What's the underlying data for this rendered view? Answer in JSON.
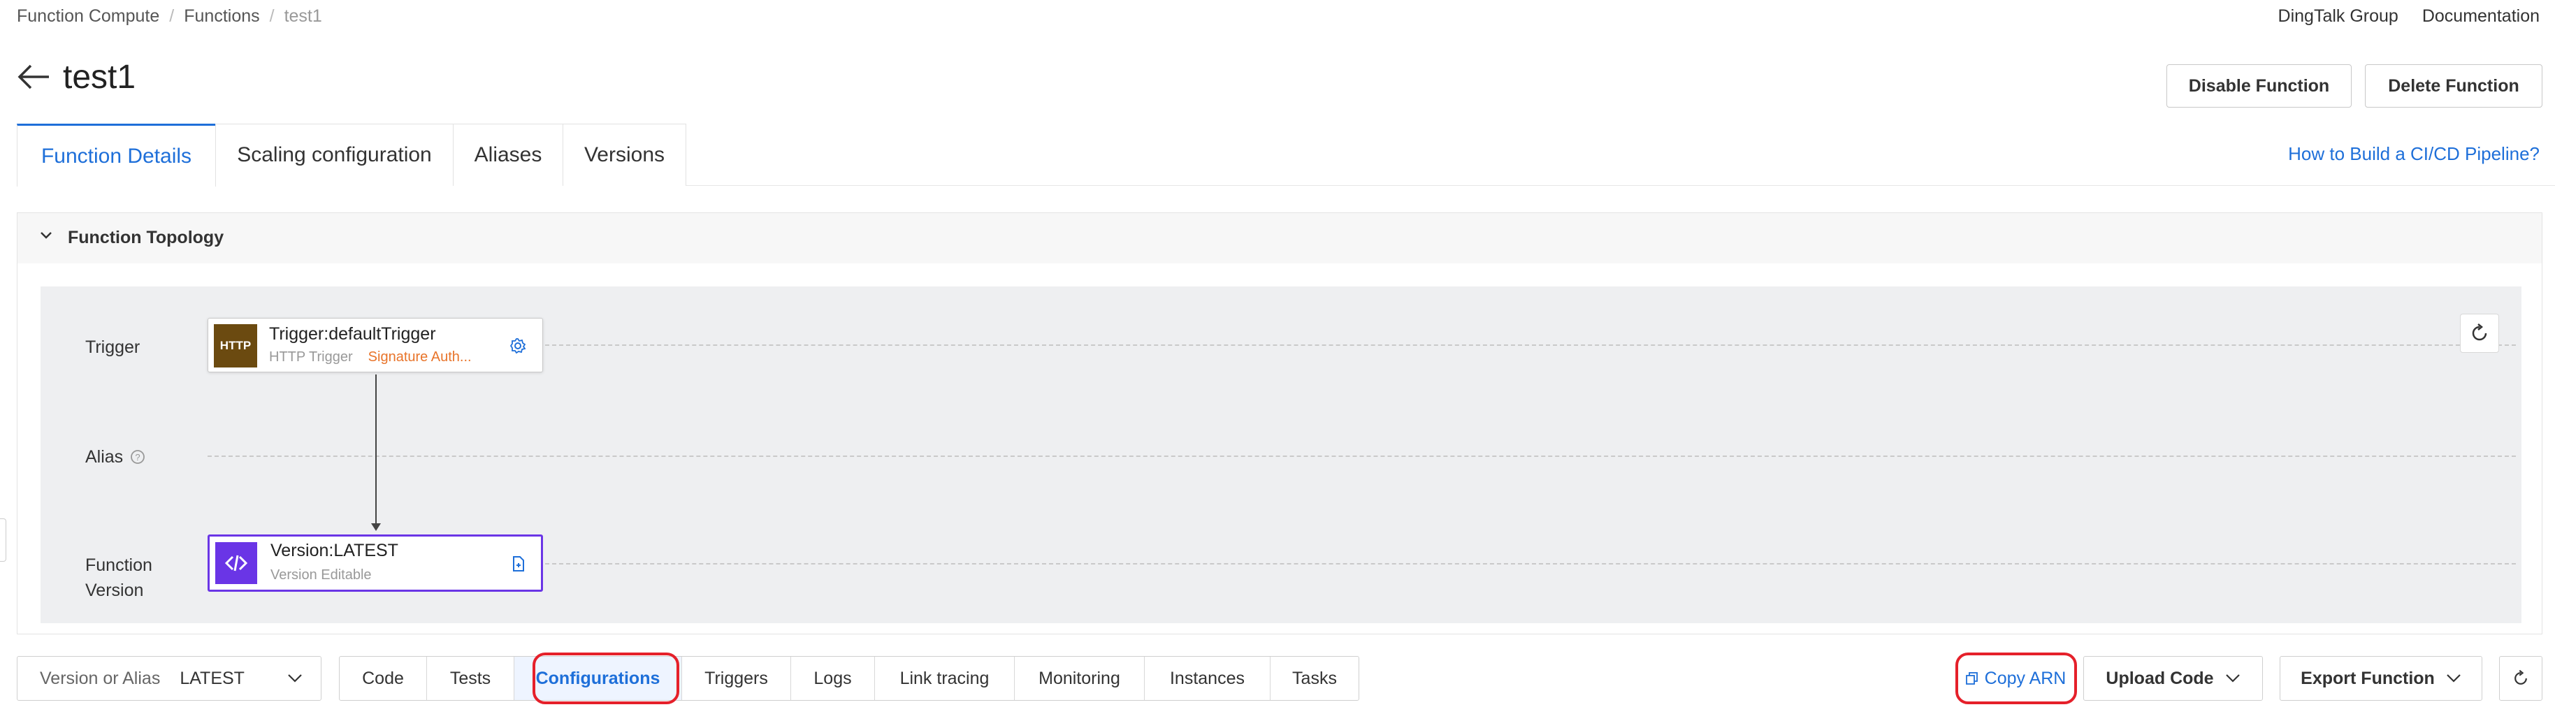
{
  "breadcrumb": [
    "Function Compute",
    "Functions",
    "test1"
  ],
  "top_links": [
    "DingTalk Group",
    "Documentation"
  ],
  "page": {
    "title": "test1"
  },
  "header_buttons": {
    "disable": "Disable Function",
    "delete": "Delete Function"
  },
  "tabs": [
    {
      "label": "Function Details",
      "active": true
    },
    {
      "label": "Scaling configuration",
      "active": false
    },
    {
      "label": "Aliases",
      "active": false
    },
    {
      "label": "Versions",
      "active": false
    }
  ],
  "cicd_link": "How to Build a CI/CD Pipeline?",
  "topology": {
    "title": "Function Topology",
    "rows": {
      "trigger": "Trigger",
      "alias": "Alias",
      "version_line1": "Function",
      "version_line2": "Version"
    },
    "trigger_node": {
      "badge": "HTTP",
      "title": "Trigger:defaultTrigger",
      "type": "HTTP Trigger",
      "auth": "Signature Auth..."
    },
    "version_node": {
      "title": "Version:LATEST",
      "sub": "Version Editable"
    }
  },
  "toolbar": {
    "version_label": "Version or Alias",
    "version_value": "LATEST",
    "subtabs": [
      "Code",
      "Tests",
      "Configurations",
      "Triggers",
      "Logs",
      "Link tracing",
      "Monitoring",
      "Instances",
      "Tasks"
    ],
    "active_subtab": "Configurations",
    "copy_arn": "Copy ARN",
    "upload_code": "Upload Code",
    "export_function": "Export Function"
  },
  "colors": {
    "accent": "#1e6fd9",
    "highlight": "#e5202a",
    "version_purple": "#6a35e6",
    "http_brown": "#6b4a10",
    "auth_orange": "#e8742a"
  }
}
